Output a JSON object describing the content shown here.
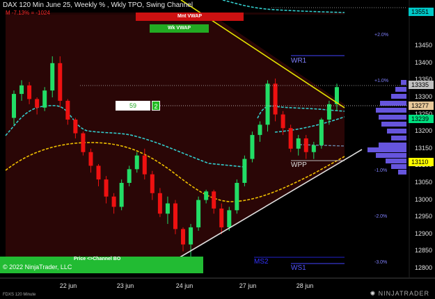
{
  "header": {
    "title": "DAX 120 Min June 25, Weekly % , Wkly TPO, Swing Channel",
    "sub": "M -7.13% = -1024"
  },
  "vwap": {
    "monthly": "Mnt VWAP",
    "weekly": "Wk VWAP"
  },
  "counter": {
    "value": "59",
    "badge": "2"
  },
  "levels": {
    "wr1": "WR1",
    "wpp": "WPP",
    "ms2": "MS2",
    "ws1": "WS1"
  },
  "channel_label": "Price <>Channel BO",
  "copyright": "© 2022 NinjaTrader, LLC",
  "footer_left": "FDXS 120 Minute",
  "brand": "NINJATRADER",
  "y_axis": [
    "13450",
    "13400",
    "13350",
    "13300",
    "13250",
    "13200",
    "13150",
    "13100",
    "13050",
    "13000",
    "12950",
    "12900",
    "12850",
    "12800"
  ],
  "percent_labels": [
    "+2.0%",
    "+1.0%",
    "-1.0%",
    "-2.0%",
    "-3.0%"
  ],
  "price_boxes": [
    {
      "value": "13551",
      "color": "#00c8c8"
    },
    {
      "value": "13335",
      "color": "#c0c0c0"
    },
    {
      "value": "13277",
      "color": "#e8c99a"
    },
    {
      "value": "13239",
      "color": "#00e080"
    },
    {
      "value": "13110",
      "color": "#ffff00"
    }
  ],
  "x_axis": [
    "22 jun",
    "23 jun",
    "24 jun",
    "27 jun",
    "28 jun"
  ],
  "colors": {
    "up": "#22dd66",
    "down": "#ee1111",
    "vwap": "#33cccc",
    "trend": "#e6e600",
    "yellow_dash": "#f0c000",
    "profile": "#6655dd"
  },
  "chart_data": {
    "type": "candlestick",
    "series": [
      {
        "o": 13240,
        "h": 13320,
        "l": 13220,
        "c": 13310
      },
      {
        "o": 13310,
        "h": 13350,
        "l": 13290,
        "c": 13335
      },
      {
        "o": 13335,
        "h": 13345,
        "l": 13280,
        "c": 13295
      },
      {
        "o": 13295,
        "h": 13300,
        "l": 13250,
        "c": 13270
      },
      {
        "o": 13270,
        "h": 13330,
        "l": 13260,
        "c": 13320
      },
      {
        "o": 13320,
        "h": 13420,
        "l": 13300,
        "c": 13400
      },
      {
        "o": 13400,
        "h": 13420,
        "l": 13270,
        "c": 13290
      },
      {
        "o": 13290,
        "h": 13295,
        "l": 13220,
        "c": 13235
      },
      {
        "o": 13235,
        "h": 13240,
        "l": 13180,
        "c": 13195
      },
      {
        "o": 13195,
        "h": 13200,
        "l": 13130,
        "c": 13140
      },
      {
        "o": 13140,
        "h": 13150,
        "l": 13080,
        "c": 13100
      },
      {
        "o": 13100,
        "h": 13105,
        "l": 13040,
        "c": 13060
      },
      {
        "o": 13060,
        "h": 13070,
        "l": 12990,
        "c": 13010
      },
      {
        "o": 13010,
        "h": 13020,
        "l": 12960,
        "c": 12980
      },
      {
        "o": 12980,
        "h": 13060,
        "l": 12970,
        "c": 13050
      },
      {
        "o": 13050,
        "h": 13100,
        "l": 13040,
        "c": 13090
      },
      {
        "o": 13090,
        "h": 13140,
        "l": 13080,
        "c": 13130
      },
      {
        "o": 13130,
        "h": 13150,
        "l": 13060,
        "c": 13075
      },
      {
        "o": 13075,
        "h": 13085,
        "l": 13000,
        "c": 13020
      },
      {
        "o": 13020,
        "h": 13035,
        "l": 12950,
        "c": 12960
      },
      {
        "o": 12960,
        "h": 13010,
        "l": 12930,
        "c": 12990
      },
      {
        "o": 12990,
        "h": 13000,
        "l": 12900,
        "c": 12915
      },
      {
        "o": 12915,
        "h": 12920,
        "l": 12850,
        "c": 12870
      },
      {
        "o": 12870,
        "h": 12930,
        "l": 12830,
        "c": 12920
      },
      {
        "o": 12920,
        "h": 13010,
        "l": 12910,
        "c": 13000
      },
      {
        "o": 13000,
        "h": 13030,
        "l": 12990,
        "c": 13025
      },
      {
        "o": 13025,
        "h": 13030,
        "l": 12960,
        "c": 12975
      },
      {
        "o": 12975,
        "h": 12990,
        "l": 12900,
        "c": 12920
      },
      {
        "o": 12920,
        "h": 12980,
        "l": 12910,
        "c": 12970
      },
      {
        "o": 12970,
        "h": 13060,
        "l": 12960,
        "c": 13050
      },
      {
        "o": 13050,
        "h": 13130,
        "l": 13040,
        "c": 13120
      },
      {
        "o": 13120,
        "h": 13200,
        "l": 13110,
        "c": 13190
      },
      {
        "o": 13190,
        "h": 13230,
        "l": 13170,
        "c": 13220
      },
      {
        "o": 13220,
        "h": 13350,
        "l": 13200,
        "c": 13340
      },
      {
        "o": 13340,
        "h": 13355,
        "l": 13230,
        "c": 13250
      },
      {
        "o": 13250,
        "h": 13260,
        "l": 13190,
        "c": 13210
      },
      {
        "o": 13210,
        "h": 13220,
        "l": 13140,
        "c": 13150
      },
      {
        "o": 13150,
        "h": 13190,
        "l": 13130,
        "c": 13180
      },
      {
        "o": 13180,
        "h": 13190,
        "l": 13120,
        "c": 13140
      },
      {
        "o": 13140,
        "h": 13170,
        "l": 13120,
        "c": 13160
      },
      {
        "o": 13160,
        "h": 13240,
        "l": 13150,
        "c": 13235
      },
      {
        "o": 13235,
        "h": 13290,
        "l": 13220,
        "c": 13280
      },
      {
        "o": 13280,
        "h": 13340,
        "l": 13260,
        "c": 13330
      }
    ]
  }
}
